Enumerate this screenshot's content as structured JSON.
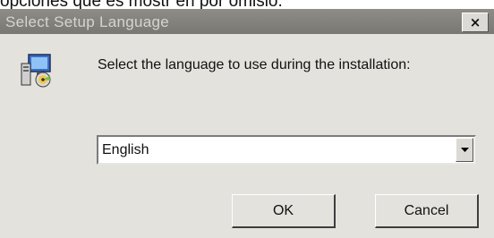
{
  "background_text": "opciones que es mostr en por omisió.",
  "dialog": {
    "title": "Select Setup Language",
    "close_label": "×",
    "prompt": "Select the language to use during the installation:",
    "language_select": {
      "selected": "English"
    },
    "buttons": {
      "ok": "OK",
      "cancel": "Cancel"
    }
  },
  "icons": [
    "setup-computer-icon",
    "close-icon",
    "dropdown-arrow-icon"
  ],
  "colors": {
    "titlebar": "#8e8c86",
    "title_text": "#d6d4cf",
    "dialog_bg": "#e4e2dc"
  }
}
